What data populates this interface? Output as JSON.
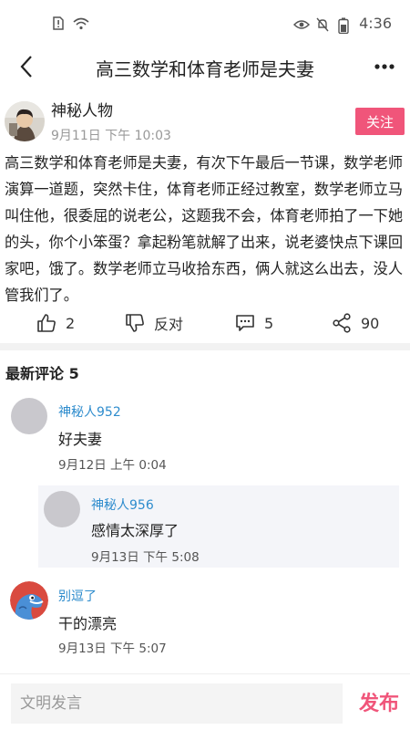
{
  "status_bar": {
    "time": "4:36"
  },
  "header": {
    "title": "高三数学和体育老师是夫妻"
  },
  "post": {
    "author": "神秘人物",
    "time": "9月11日 下午 10:03",
    "follow_label": "关注",
    "body": "高三数学和体育老师是夫妻，有次下午最后一节课，数学老师演算一道题，突然卡住，体育老师正经过教室，数学老师立马叫住他，很委屈的说老公，这题我不会，体育老师拍了一下她的头，你个小笨蛋？拿起粉笔就解了出来，说老婆快点下课回家吧，饿了。数学老师立马收拾东西，俩人就这么出去，没人管我们了。",
    "likes": "2",
    "dislike_label": "反对",
    "comments": "5",
    "shares": "90"
  },
  "comments_heading": "最新评论 5",
  "comments": [
    {
      "name": "神秘人952",
      "text": "好夫妻",
      "time": "9月12日 上午 0:04"
    },
    {
      "name": "神秘人956",
      "text": "感情太深厚了",
      "time": "9月13日 下午 5:08"
    },
    {
      "name": "别逗了",
      "text": "干的漂亮",
      "time": "9月13日 下午 5:07"
    }
  ],
  "bottom_bar": {
    "input_placeholder": "文明发言",
    "publish_label": "发布"
  },
  "colors": {
    "accent": "#f0557a",
    "link": "#2e8ccd"
  }
}
